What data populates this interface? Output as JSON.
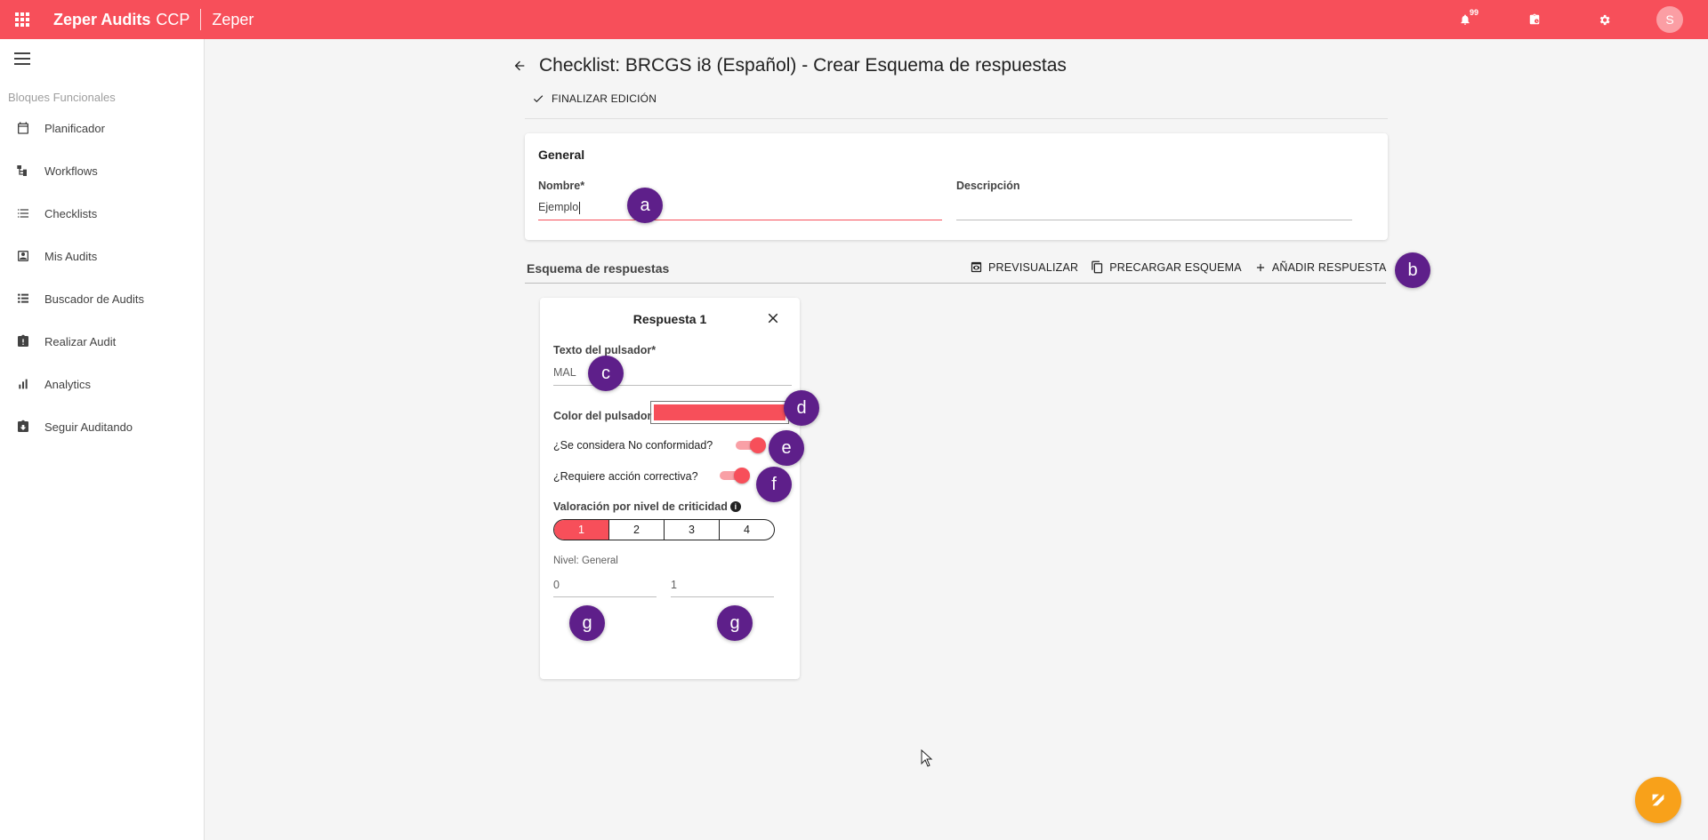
{
  "app": {
    "brand": "Zeper Audits",
    "brand_suffix": "CCP",
    "organization": "Zeper",
    "notification_count": "99",
    "avatar_initial": "S"
  },
  "sidebar": {
    "section_title": "Bloques Funcionales",
    "items": [
      {
        "label": "Planificador",
        "icon": "calendar-icon"
      },
      {
        "label": "Workflows",
        "icon": "workflow-icon"
      },
      {
        "label": "Checklists",
        "icon": "list-icon"
      },
      {
        "label": "Mis Audits",
        "icon": "contact-card-icon"
      },
      {
        "label": "Buscador de Audits",
        "icon": "search-list-icon"
      },
      {
        "label": "Realizar Audit",
        "icon": "clipboard-alert-icon"
      },
      {
        "label": "Analytics",
        "icon": "bar-chart-icon"
      },
      {
        "label": "Seguir Auditando",
        "icon": "clipboard-download-icon"
      }
    ]
  },
  "page": {
    "title": "Checklist: BRCGS i8 (Español) - Crear Esquema de respuestas",
    "finish_label": "FINALIZAR EDICIÓN"
  },
  "general": {
    "title": "General",
    "name_label": "Nombre*",
    "name_value": "Ejemplo",
    "description_label": "Descripción",
    "description_value": ""
  },
  "schema": {
    "title": "Esquema de respuestas",
    "actions": {
      "preview": "PREVISUALIZAR",
      "preload": "PRECARGAR ESQUEMA",
      "add": "AÑADIR RESPUESTA"
    }
  },
  "response": {
    "title": "Respuesta 1",
    "button_text_label": "Texto del pulsador*",
    "button_text_value": "MAL",
    "color_label": "Color del pulsador",
    "color_value": "#f74f5a",
    "nonconformity_label": "¿Se considera No conformidad?",
    "nonconformity_on": true,
    "corrective_label": "¿Requiere acción correctiva?",
    "corrective_on": true,
    "criticality_label": "Valoración por nivel de criticidad",
    "criticality_levels": [
      "1",
      "2",
      "3",
      "4"
    ],
    "criticality_selected": "1",
    "level_label": "Nivel: General",
    "score_min": "0",
    "score_max": "1"
  },
  "markers": [
    "a",
    "b",
    "c",
    "d",
    "e",
    "f",
    "g",
    "g"
  ],
  "colors": {
    "primary": "#f74f5a",
    "marker": "#5e1f8a",
    "fab": "#f8a11a"
  }
}
